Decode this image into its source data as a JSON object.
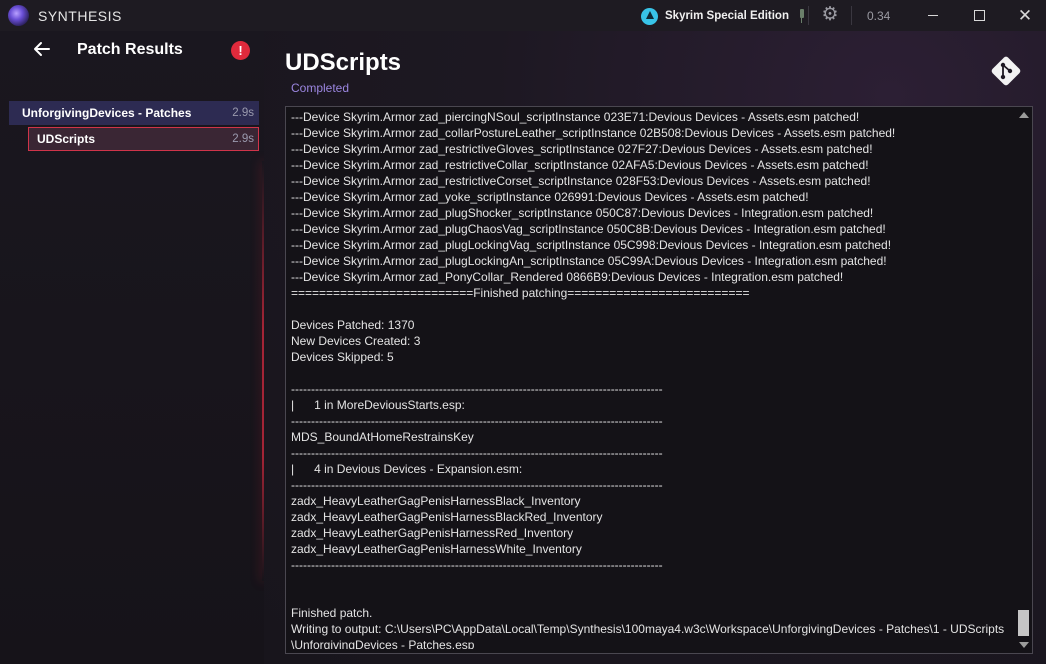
{
  "app": {
    "title": "SYNTHESIS",
    "game": "Skyrim Special Edition",
    "version": "0.34"
  },
  "sidebar": {
    "title": "Patch Results",
    "group": {
      "name": "UnforgivingDevices - Patches",
      "time": "2.9s"
    },
    "child": {
      "name": "UDScripts",
      "time": "2.9s"
    }
  },
  "main": {
    "title": "UDScripts",
    "status": "Completed"
  },
  "log": [
    "---Device Skyrim.Armor zad_piercingNSoul_scriptInstance 023E71:Devious Devices - Assets.esm patched!",
    "---Device Skyrim.Armor zad_collarPostureLeather_scriptInstance 02B508:Devious Devices - Assets.esm patched!",
    "---Device Skyrim.Armor zad_restrictiveGloves_scriptInstance 027F27:Devious Devices - Assets.esm patched!",
    "---Device Skyrim.Armor zad_restrictiveCollar_scriptInstance 02AFA5:Devious Devices - Assets.esm patched!",
    "---Device Skyrim.Armor zad_restrictiveCorset_scriptInstance 028F53:Devious Devices - Assets.esm patched!",
    "---Device Skyrim.Armor zad_yoke_scriptInstance 026991:Devious Devices - Assets.esm patched!",
    "---Device Skyrim.Armor zad_plugShocker_scriptInstance 050C87:Devious Devices - Integration.esm patched!",
    "---Device Skyrim.Armor zad_plugChaosVag_scriptInstance 050C8B:Devious Devices - Integration.esm patched!",
    "---Device Skyrim.Armor zad_plugLockingVag_scriptInstance 05C998:Devious Devices - Integration.esm patched!",
    "---Device Skyrim.Armor zad_plugLockingAn_scriptInstance 05C99A:Devious Devices - Integration.esm patched!",
    "---Device Skyrim.Armor zad_PonyCollar_Rendered 0866B9:Devious Devices - Integration.esm patched!",
    "==========================Finished patching==========================",
    "",
    "Devices Patched: 1370",
    "New Devices Created: 3",
    "Devices Skipped: 5",
    "",
    "---------------------------------------------------------------------------------------------",
    "|      1 in MoreDeviousStarts.esp:",
    "---------------------------------------------------------------------------------------------",
    "MDS_BoundAtHomeRestrainsKey",
    "---------------------------------------------------------------------------------------------",
    "|      4 in Devious Devices - Expansion.esm:",
    "---------------------------------------------------------------------------------------------",
    "zadx_HeavyLeatherGagPenisHarnessBlack_Inventory",
    "zadx_HeavyLeatherGagPenisHarnessBlackRed_Inventory",
    "zadx_HeavyLeatherGagPenisHarnessRed_Inventory",
    "zadx_HeavyLeatherGagPenisHarnessWhite_Inventory",
    "---------------------------------------------------------------------------------------------",
    "",
    "",
    "Finished patch.",
    "Writing to output: C:\\Users\\PC\\AppData\\Local\\Temp\\Synthesis\\100maya4.w3c\\Workspace\\UnforgivingDevices - Patches\\1 - UDScripts",
    "\\UnforgivingDevices - Patches.esp"
  ],
  "icons": {
    "logo": "synthesis-logo-icon",
    "game": "skyrim-icon",
    "plug": "plug-icon",
    "settings": "gear-icon",
    "back": "back-arrow-icon",
    "error": "error-icon",
    "git": "git-icon"
  },
  "colors": {
    "accent": "#9b86e0",
    "error": "#e02a3c",
    "selected_group": "#2d2b52",
    "selected_child_border": "#d0344a"
  }
}
